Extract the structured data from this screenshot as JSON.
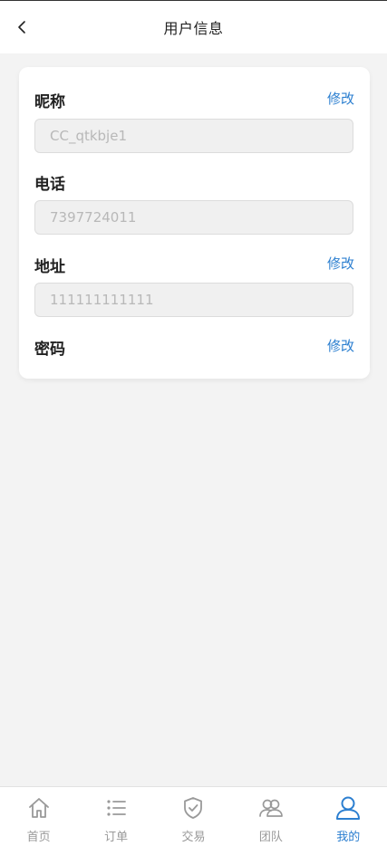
{
  "header": {
    "title": "用户信息"
  },
  "profile": {
    "nickname": {
      "label": "昵称",
      "edit_label": "修改",
      "value": "CC_qtkbje1"
    },
    "phone": {
      "label": "电话",
      "value": "7397724011"
    },
    "address": {
      "label": "地址",
      "edit_label": "修改",
      "value": "111111111111"
    },
    "password": {
      "label": "密码",
      "edit_label": "修改"
    }
  },
  "tabbar": {
    "active_color": "#2c7fd0",
    "inactive_color": "#999999",
    "items": [
      {
        "label": "首页",
        "icon": "home-icon"
      },
      {
        "label": "订单",
        "icon": "list-icon"
      },
      {
        "label": "交易",
        "icon": "shield-check-icon"
      },
      {
        "label": "团队",
        "icon": "team-icon"
      },
      {
        "label": "我的",
        "icon": "user-icon",
        "active": true
      }
    ]
  }
}
